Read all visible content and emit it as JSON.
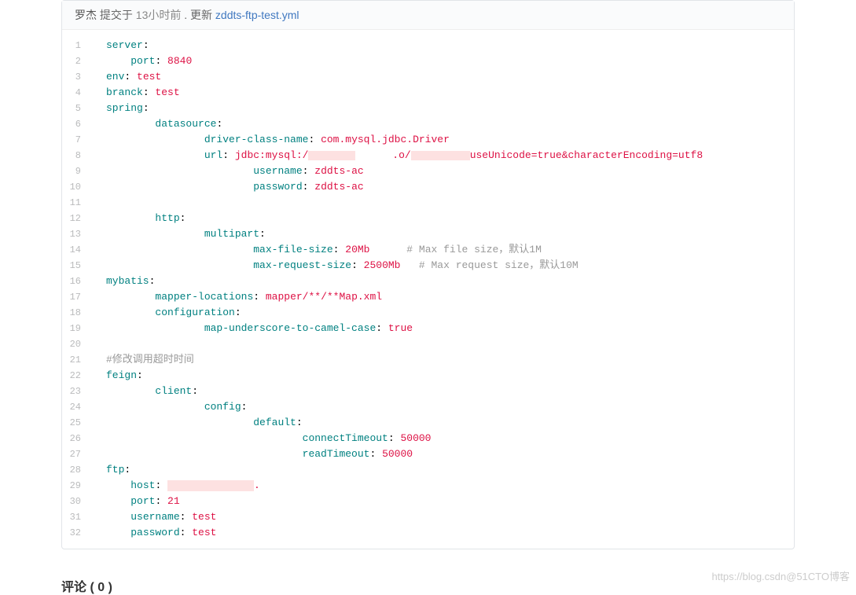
{
  "commit": {
    "author": "罗杰",
    "action": "提交于",
    "time": "13小时前",
    "sep": ". 更新 ",
    "filename": "zddts-ftp-test.yml"
  },
  "lines": [
    {
      "n": "1",
      "indent": 0,
      "key": "server",
      "colon": ":"
    },
    {
      "n": "2",
      "indent": 1,
      "key": "port",
      "colon": ": ",
      "val": "8840",
      "vclass": "val-num"
    },
    {
      "n": "3",
      "indent": 0,
      "key": "env",
      "colon": ": ",
      "val": "test",
      "vclass": "val-str"
    },
    {
      "n": "4",
      "indent": 0,
      "key": "branck",
      "colon": ": ",
      "val": "test",
      "vclass": "val-str"
    },
    {
      "n": "5",
      "indent": 0,
      "key": "spring",
      "colon": ":"
    },
    {
      "n": "6",
      "indent": 2,
      "key": "datasource",
      "colon": ":"
    },
    {
      "n": "7",
      "indent": 4,
      "key": "driver-class-name",
      "colon": ": ",
      "val": "com.mysql.jdbc.Driver",
      "vclass": "val-str"
    },
    {
      "n": "8",
      "indent": 4,
      "key": "url",
      "colon": ": ",
      "special": "url"
    },
    {
      "n": "9",
      "indent": 6,
      "key": "username",
      "colon": ": ",
      "val": "zddts-ac",
      "vclass": "val-str"
    },
    {
      "n": "10",
      "indent": 6,
      "key": "password",
      "colon": ": ",
      "val": "zddts-ac",
      "vclass": "val-str"
    },
    {
      "n": "11"
    },
    {
      "n": "12",
      "indent": 2,
      "key": "http",
      "colon": ":"
    },
    {
      "n": "13",
      "indent": 4,
      "key": "multipart",
      "colon": ":"
    },
    {
      "n": "14",
      "indent": 6,
      "key": "max-file-size",
      "colon": ": ",
      "val": "20Mb",
      "vclass": "val-num",
      "comment": "      # Max file size，默认1M"
    },
    {
      "n": "15",
      "indent": 6,
      "key": "max-request-size",
      "colon": ": ",
      "val": "2500Mb",
      "vclass": "val-num",
      "comment": "   # Max request size，默认10M"
    },
    {
      "n": "16",
      "indent": 0,
      "key": "mybatis",
      "colon": ":"
    },
    {
      "n": "17",
      "indent": 2,
      "key": "mapper-locations",
      "colon": ": ",
      "val": "mapper/**/**Map.xml",
      "vclass": "val-str"
    },
    {
      "n": "18",
      "indent": 2,
      "key": "configuration",
      "colon": ":"
    },
    {
      "n": "19",
      "indent": 4,
      "key": "map-underscore-to-camel-case",
      "colon": ": ",
      "val": "true",
      "vclass": "val-bool"
    },
    {
      "n": "20"
    },
    {
      "n": "21",
      "indent": 0,
      "raw": "#修改调用超时时间",
      "rclass": "comment"
    },
    {
      "n": "22",
      "indent": 0,
      "key": "feign",
      "colon": ":"
    },
    {
      "n": "23",
      "indent": 2,
      "key": "client",
      "colon": ":"
    },
    {
      "n": "24",
      "indent": 4,
      "key": "config",
      "colon": ":"
    },
    {
      "n": "25",
      "indent": 6,
      "key": "default",
      "colon": ":"
    },
    {
      "n": "26",
      "indent": 8,
      "key": "connectTimeout",
      "colon": ": ",
      "val": "50000",
      "vclass": "val-num"
    },
    {
      "n": "27",
      "indent": 8,
      "key": "readTimeout",
      "colon": ": ",
      "val": "50000",
      "vclass": "val-num"
    },
    {
      "n": "28",
      "indent": 0,
      "key": "ftp",
      "colon": ":"
    },
    {
      "n": "29",
      "indent": 1,
      "key": "host",
      "colon": ": ",
      "special": "host"
    },
    {
      "n": "30",
      "indent": 1,
      "key": "port",
      "colon": ": ",
      "val": "21",
      "vclass": "val-num"
    },
    {
      "n": "31",
      "indent": 1,
      "key": "username",
      "colon": ": ",
      "val": "test",
      "vclass": "val-str"
    },
    {
      "n": "32",
      "indent": 1,
      "key": "password",
      "colon": ": ",
      "val": "test",
      "vclass": "val-str"
    }
  ],
  "url_parts": {
    "prefix": "jdbc:mysql:/",
    "mid": ".o/",
    "suffix": "useUnicode=true&characterEncoding=utf8"
  },
  "host_suffix": ".",
  "comments_heading": "评论 ( 0 )",
  "watermark": "https://blog.csdn@51CTO博客"
}
